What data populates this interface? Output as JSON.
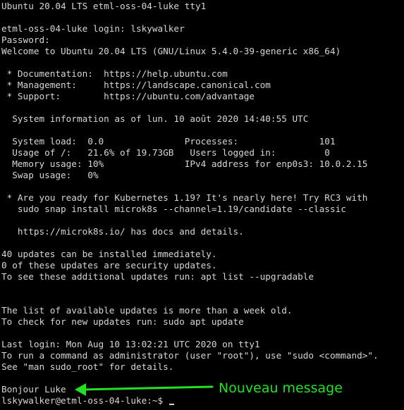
{
  "terminal": {
    "lines": [
      "Ubuntu 20.04 LTS etml-oss-04-luke tty1",
      "",
      "etml-oss-04-luke login: lskywalker",
      "Password:",
      "Welcome to Ubuntu 20.04 LTS (GNU/Linux 5.4.0-39-generic x86_64)",
      "",
      " * Documentation:  https://help.ubuntu.com",
      " * Management:     https://landscape.canonical.com",
      " * Support:        https://ubuntu.com/advantage",
      "",
      "  System information as of lun. 10 août 2020 14:40:55 UTC",
      "",
      "  System load:  0.0               Processes:               101",
      "  Usage of /:   21.6% of 19.73GB   Users logged in:         0",
      "  Memory usage: 10%               IPv4 address for enp0s3: 10.0.2.15",
      "  Swap usage:   0%",
      "",
      " * Are you ready for Kubernetes 1.19? It's nearly here! Try RC3 with",
      "   sudo snap install microk8s --channel=1.19/candidate --classic",
      "",
      "   https://microk8s.io/ has docs and details.",
      "",
      "40 updates can be installed immediately.",
      "0 of these updates are security updates.",
      "To see these additional updates run: apt list --upgradable",
      "",
      "",
      "The list of available updates is more than a week old.",
      "To check for new updates run: sudo apt update",
      "",
      "Last login: Mon Aug 10 13:02:21 UTC 2020 on tty1",
      "To run a command as administrator (user \"root\"), use \"sudo <command>\".",
      "See \"man sudo_root\" for details.",
      "",
      "Bonjour Luke"
    ],
    "prompt": "lskywalker@etml-oss-04-luke:~$ "
  },
  "annotation": {
    "label": "Nouveau message",
    "color": "#22e022",
    "icon": "arrow-left-icon"
  },
  "colors": {
    "background": "#000000",
    "text": "#d6d6d6"
  }
}
